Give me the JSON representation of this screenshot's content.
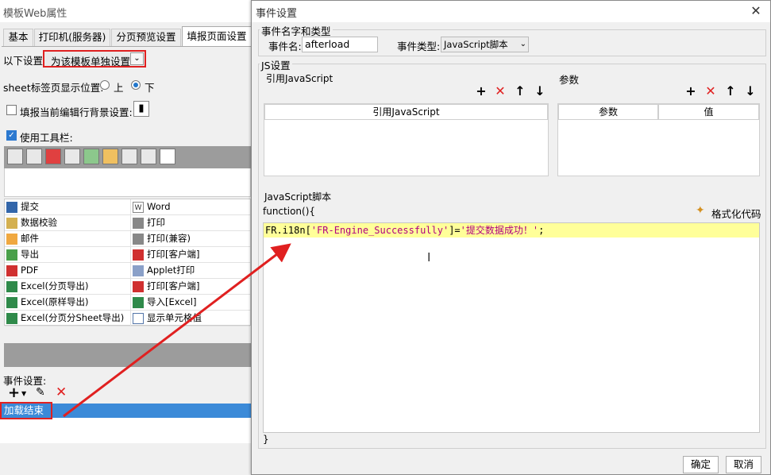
{
  "bg_window": {
    "title": "模板Web属性",
    "tabs": [
      "基本",
      "打印机(服务器)",
      "分页预览设置",
      "填报页面设置"
    ],
    "settings_label": "以下设置",
    "settings_value": "为该模板单独设置",
    "sheet_label": "sheet标签页显示位置:",
    "radio_top": "上",
    "radio_bottom": "下",
    "bg_setting_label": "填报当前编辑行背景设置:",
    "use_toolbar_label": "使用工具栏:",
    "buttons_left": [
      "提交",
      "数据校验",
      "邮件",
      "导出",
      "PDF",
      "Excel(分页导出)",
      "Excel(原样导出)",
      "Excel(分页分Sheet导出)"
    ],
    "buttons_right": [
      "Word",
      "打印",
      "打印(兼容)",
      "打印[客户端]",
      "Applet打印",
      "打印[客户端]",
      "导入[Excel]",
      "显示单元格值"
    ],
    "event_label": "事件设置:",
    "event_item": "加载结束"
  },
  "dialog": {
    "title": "事件设置",
    "name_type_group": "事件名字和类型",
    "event_name_label": "事件名:",
    "event_name_value": "afterload",
    "event_type_label": "事件类型:",
    "event_type_value": "JavaScript脚本",
    "js_group": "JS设置",
    "ref_js_label": "引用JavaScript",
    "ref_js_header": "引用JavaScript",
    "params_label": "参数",
    "params_col1": "参数",
    "params_col2": "值",
    "js_script_label": "JavaScript脚本",
    "function_open": "function(){",
    "format_code": "格式化代码",
    "code_part1": "FR.i18n[",
    "code_part2": "'FR-Engine_Successfully'",
    "code_part3": "]=",
    "code_part4": "'提交数据成功！'",
    "code_part5": ";",
    "function_close": "}",
    "ok_button": "确定",
    "cancel_button": "取消"
  },
  "colors": {
    "highlight_red": "#e02020",
    "selection_blue": "#3b8ad8",
    "code_line_bg": "#ffff99",
    "string_color": "#b00080"
  }
}
